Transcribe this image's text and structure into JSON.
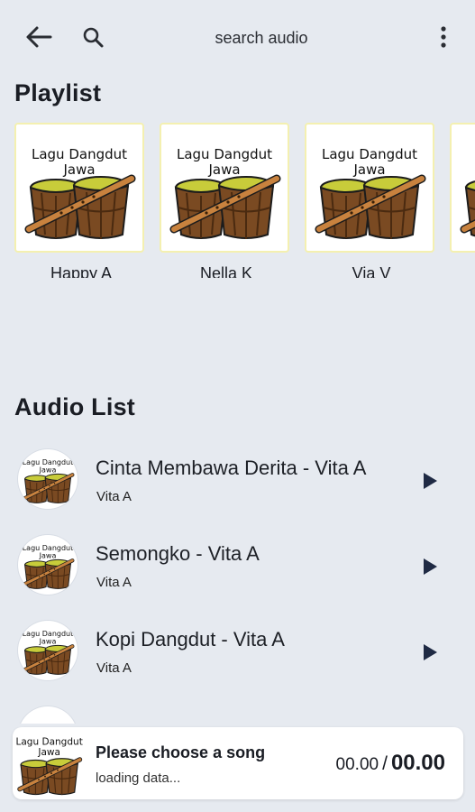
{
  "header": {
    "back_icon": "arrow-left-icon",
    "search_icon": "search-icon",
    "search_placeholder": "search audio",
    "more_icon": "more-vertical-icon"
  },
  "playlist": {
    "title": "Playlist",
    "thumb_caption_line1": "Lagu Dangdut",
    "thumb_caption_line2": "Jawa",
    "items": [
      {
        "name": "Happy A"
      },
      {
        "name": "Nella K"
      },
      {
        "name": "Via V"
      }
    ]
  },
  "audio_list": {
    "title": "Audio List",
    "play_icon": "play-icon",
    "items": [
      {
        "title": "Cinta Membawa Derita - Vita A",
        "artist": "Vita A"
      },
      {
        "title": "Semongko - Vita A",
        "artist": "Vita A"
      },
      {
        "title": "Kopi Dangdut - Vita A",
        "artist": "Vita A"
      }
    ]
  },
  "player": {
    "title": "Please choose a song",
    "status": "loading data...",
    "current_time": "00.00",
    "separator": "/",
    "total_time": "00.00"
  },
  "colors": {
    "background": "#e6eaf0",
    "drum_wood": "#7a4a22",
    "drum_head": "#c8cc3a",
    "flute": "#c8823e"
  }
}
